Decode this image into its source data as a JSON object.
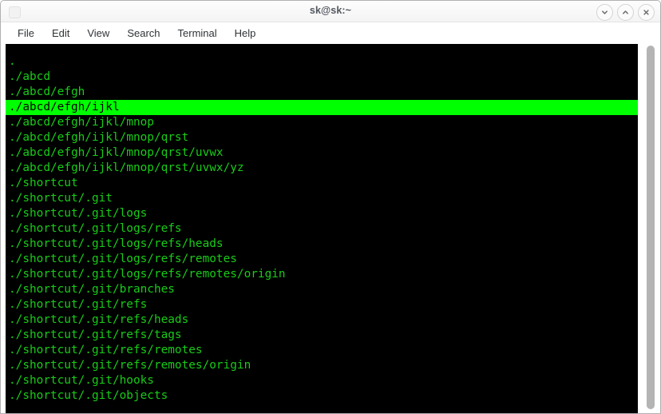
{
  "window": {
    "title": "sk@sk:~",
    "icon": "window-menu-icon",
    "controls": [
      {
        "name": "minimize-button",
        "glyph": "chevron-down"
      },
      {
        "name": "maximize-button",
        "glyph": "chevron-up"
      },
      {
        "name": "close-button",
        "glyph": "cross"
      }
    ]
  },
  "menubar": {
    "items": [
      {
        "label": "File"
      },
      {
        "label": "Edit"
      },
      {
        "label": "View"
      },
      {
        "label": "Search"
      },
      {
        "label": "Terminal"
      },
      {
        "label": "Help"
      }
    ]
  },
  "colors": {
    "terminal_background": "#000000",
    "terminal_foreground": "#18cc18",
    "selection_background": "#00ff00",
    "selection_foreground": "#000000",
    "scrollbar_thumb": "#b4b4b4",
    "titlebar_text": "#53585f"
  },
  "terminal": {
    "selected_line_index": 3,
    "lines": [
      ".",
      "./abcd",
      "./abcd/efgh",
      "./abcd/efgh/ijkl",
      "./abcd/efgh/ijkl/mnop",
      "./abcd/efgh/ijkl/mnop/qrst",
      "./abcd/efgh/ijkl/mnop/qrst/uvwx",
      "./abcd/efgh/ijkl/mnop/qrst/uvwx/yz",
      "./shortcut",
      "./shortcut/.git",
      "./shortcut/.git/logs",
      "./shortcut/.git/logs/refs",
      "./shortcut/.git/logs/refs/heads",
      "./shortcut/.git/logs/refs/remotes",
      "./shortcut/.git/logs/refs/remotes/origin",
      "./shortcut/.git/branches",
      "./shortcut/.git/refs",
      "./shortcut/.git/refs/heads",
      "./shortcut/.git/refs/tags",
      "./shortcut/.git/refs/remotes",
      "./shortcut/.git/refs/remotes/origin",
      "./shortcut/.git/hooks",
      "./shortcut/.git/objects"
    ]
  }
}
